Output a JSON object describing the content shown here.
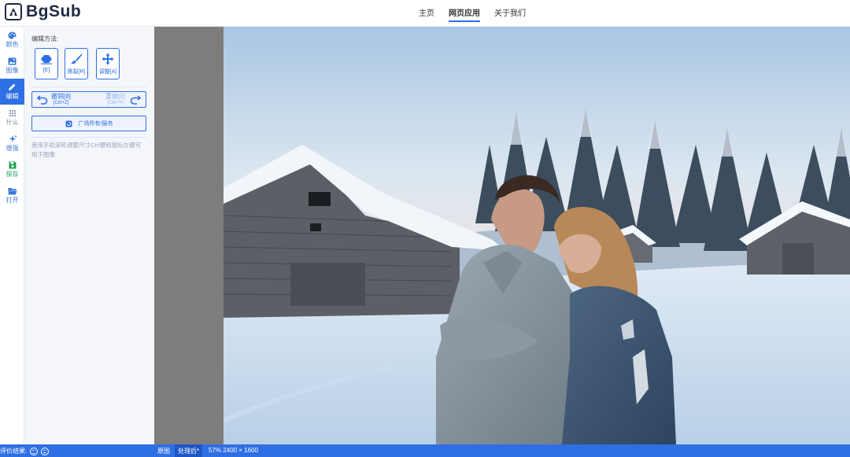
{
  "app": {
    "logo_text": "BgSub"
  },
  "nav": [
    {
      "label": "主页",
      "active": false
    },
    {
      "label": "网页应用",
      "active": true
    },
    {
      "label": "关于我们",
      "active": false
    }
  ],
  "rail": [
    {
      "label": "颜色",
      "icon": "palette-icon"
    },
    {
      "label": "图像",
      "icon": "image-icon"
    },
    {
      "label": "编辑",
      "icon": "pencil-icon",
      "active": true
    },
    {
      "label": "什么",
      "icon": "grid-icon"
    },
    {
      "label": "增强",
      "icon": "sparkle-icon"
    },
    {
      "label": "保存",
      "icon": "save-icon"
    },
    {
      "label": "打开",
      "icon": "folder-open-icon"
    }
  ],
  "panel": {
    "title": "编辑方法:",
    "tools": [
      {
        "label": "[E]",
        "icon": "eraser-icon"
      },
      {
        "label": "撕裂[R]",
        "icon": "brush-icon"
      },
      {
        "label": "调整[A]",
        "icon": "move-icon"
      }
    ],
    "undo": {
      "label": "撤销[8]",
      "shortcut": "[Ctrl+Z]"
    },
    "redo": {
      "label": "重做[0]",
      "shortcut": "[Ctrl+Y]"
    },
    "square_button": "广场所有/服务",
    "hint": "使用手机滚轮调整尺寸Ctrl键和鼠标左键可用于图像"
  },
  "status": {
    "rating_label": "评价结果:",
    "original_tab": "原图",
    "processed_tab": "处理后*",
    "zoom_info": "57% 2400 × 1600"
  },
  "colors": {
    "accent": "#2f6fe4",
    "rail_active": "#2f6fe4",
    "canvas_bg": "#7d7d7d"
  }
}
